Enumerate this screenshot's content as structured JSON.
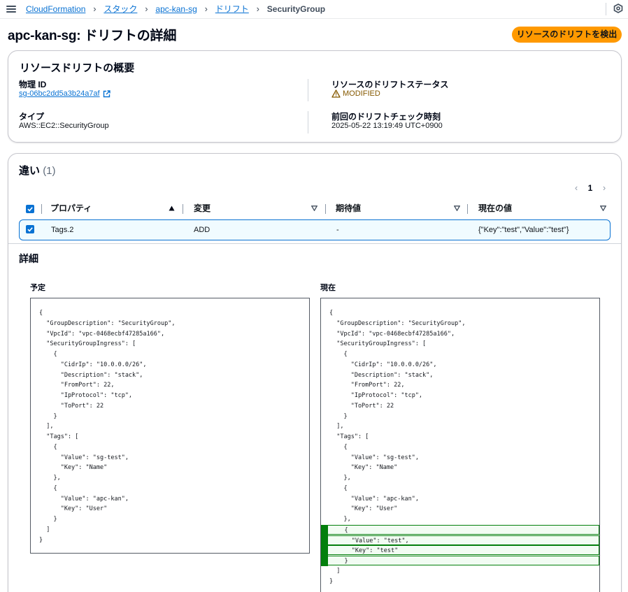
{
  "breadcrumb": {
    "items": [
      "CloudFormation",
      "スタック",
      "apc-kan-sg",
      "ドリフト"
    ],
    "current": "SecurityGroup"
  },
  "header": {
    "title": "apc-kan-sg: ドリフトの詳細",
    "detect_button": "リソースのドリフトを検出"
  },
  "summary": {
    "title": "リソースドリフトの概要",
    "physical_id_label": "物理 ID",
    "physical_id_value": "sg-06bc2dd5a3b24a7af",
    "type_label": "タイプ",
    "type_value": "AWS::EC2::SecurityGroup",
    "status_label": "リソースのドリフトステータス",
    "status_value": "MODIFIED",
    "last_check_label": "前回のドリフトチェック時刻",
    "last_check_value": "2025-05-22 13:19:49 UTC+0900"
  },
  "differences": {
    "title": "違い",
    "count": "(1)",
    "page": "1",
    "columns": [
      "プロパティ",
      "変更",
      "期待値",
      "現在の値"
    ],
    "rows": [
      {
        "property": "Tags.2",
        "change": "ADD",
        "expected": "-",
        "actual": "{\"Key\":\"test\",\"Value\":\"test\"}"
      }
    ]
  },
  "details": {
    "title": "詳細",
    "expected_title": "予定",
    "actual_title": "現在",
    "expected_lines": [
      "{",
      "  \"GroupDescription\": \"SecurityGroup\",",
      "  \"VpcId\": \"vpc-0468ecbf47285a166\",",
      "  \"SecurityGroupIngress\": [",
      "    {",
      "      \"CidrIp\": \"10.0.0.0/26\",",
      "      \"Description\": \"stack\",",
      "      \"FromPort\": 22,",
      "      \"IpProtocol\": \"tcp\",",
      "      \"ToPort\": 22",
      "    }",
      "  ],",
      "  \"Tags\": [",
      "    {",
      "      \"Value\": \"sg-test\",",
      "      \"Key\": \"Name\"",
      "    },",
      "    {",
      "      \"Value\": \"apc-kan\",",
      "      \"Key\": \"User\"",
      "    }",
      "  ]",
      "}"
    ],
    "actual_lines": [
      "{",
      "  \"GroupDescription\": \"SecurityGroup\",",
      "  \"VpcId\": \"vpc-0468ecbf47285a166\",",
      "  \"SecurityGroupIngress\": [",
      "    {",
      "      \"CidrIp\": \"10.0.0.0/26\",",
      "      \"Description\": \"stack\",",
      "      \"FromPort\": 22,",
      "      \"IpProtocol\": \"tcp\",",
      "      \"ToPort\": 22",
      "    }",
      "  ],",
      "  \"Tags\": [",
      "    {",
      "      \"Value\": \"sg-test\",",
      "      \"Key\": \"Name\"",
      "    },",
      "    {",
      "      \"Value\": \"apc-kan\",",
      "      \"Key\": \"User\"",
      "    },",
      "    {",
      "      \"Value\": \"test\",",
      "      \"Key\": \"test\"",
      "    }",
      "  ]",
      "}"
    ],
    "added_line_indices": [
      21,
      22,
      23,
      24
    ]
  },
  "colors": {
    "link": "#0972d3",
    "primary_button": "#ff9900",
    "warning": "#855900",
    "added_border": "#037f0c",
    "added_bg": "#f2fcf3"
  },
  "icons": {
    "menu": "hamburger-icon",
    "settings": "hexagon-settings-icon",
    "warning": "warning-triangle-icon",
    "external": "external-link-icon"
  }
}
